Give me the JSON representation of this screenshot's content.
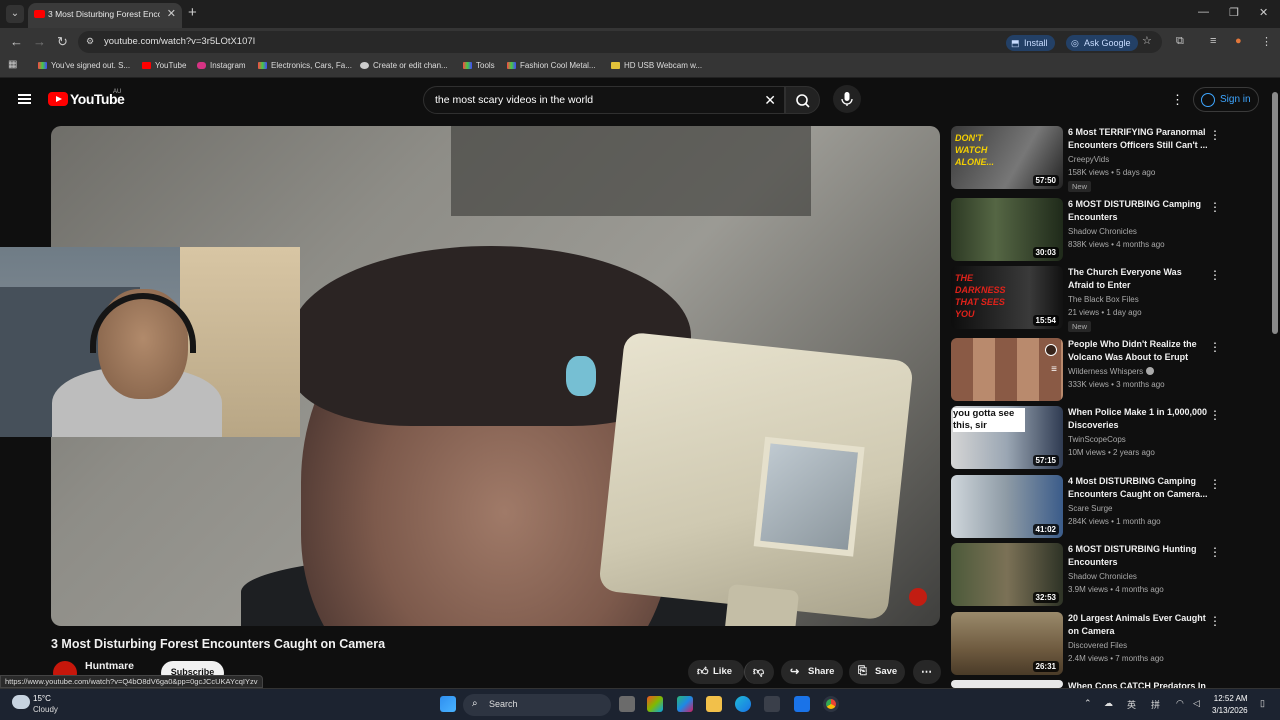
{
  "browser": {
    "tab_title": "3 Most Disturbing Forest Encou",
    "url": "youtube.com/watch?v=3r5LOtX107I",
    "install_label": "Install",
    "ask_google_label": "Ask Google",
    "bookmarks": [
      "You've signed out. S...",
      "YouTube",
      "Instagram",
      "Electronics, Cars, Fa...",
      "Create or edit chan...",
      "Tools",
      "Fashion Cool Metal...",
      "HD USB Webcam w..."
    ]
  },
  "youtube": {
    "logo_text": "YouTube",
    "region": "AU",
    "search_query": "the most scary videos in the world",
    "sign_in_label": "Sign in"
  },
  "video": {
    "title": "3 Most Disturbing Forest Encounters Caught on Camera",
    "channel": "Huntmare",
    "subscribe_label": "Subscribe",
    "like_label": "Like",
    "share_label": "Share",
    "save_label": "Save"
  },
  "status_url": "https://www.youtube.com/watch?v=Q4bO8dV6ga0&pp=0gcJCcUKAYcqIYzv",
  "recommendations": [
    {
      "title": "6 Most TERRIFYING Paranormal Encounters Officers Still Can't ...",
      "channel": "CreepyVids",
      "meta": "158K views • 5 days ago",
      "badge": "New",
      "duration": "57:50",
      "thumb_text": "DON'T WATCH ALONE..."
    },
    {
      "title": "6 MOST DISTURBING Camping Encounters",
      "channel": "Shadow Chronicles",
      "meta": "838K views • 4 months ago",
      "badge": "",
      "duration": "30:03",
      "thumb_text": ""
    },
    {
      "title": "The Church Everyone Was Afraid to Enter",
      "channel": "The Black Box Files",
      "meta": "21 views • 1 day ago",
      "badge": "New",
      "duration": "15:54",
      "thumb_text": "THE DARKNESS THAT SEES YOU"
    },
    {
      "title": "People Who Didn't Realize the Volcano Was About to Erupt",
      "channel": "Wilderness Whispers",
      "meta": "333K views • 3 months ago",
      "badge": "",
      "duration": "",
      "thumb_text": ""
    },
    {
      "title": "When Police Make 1 in 1,000,000 Discoveries",
      "channel": "TwinScopeCops",
      "meta": "10M views • 2 years ago",
      "badge": "",
      "duration": "57:15",
      "thumb_text": "you gotta see this, sir"
    },
    {
      "title": "4 Most DISTURBING Camping Encounters Caught on Camera...",
      "channel": "Scare Surge",
      "meta": "284K views • 1 month ago",
      "badge": "",
      "duration": "41:02",
      "thumb_text": ""
    },
    {
      "title": "6 MOST DISTURBING Hunting Encounters",
      "channel": "Shadow Chronicles",
      "meta": "3.9M views • 4 months ago",
      "badge": "",
      "duration": "32:53",
      "thumb_text": ""
    },
    {
      "title": "20 Largest Animals Ever Caught on Camera",
      "channel": "Discovered Files",
      "meta": "2.4M views • 7 months ago",
      "badge": "",
      "duration": "26:31",
      "thumb_text": ""
    },
    {
      "title": "When Cops CATCH Predators In",
      "channel": "",
      "meta": "",
      "badge": "",
      "duration": "",
      "thumb_text": ""
    }
  ],
  "taskbar": {
    "temperature": "15°C",
    "condition": "Cloudy",
    "search_label": "Search",
    "lang": "英",
    "time": "12:52 AM",
    "date": "3/13/2026"
  }
}
